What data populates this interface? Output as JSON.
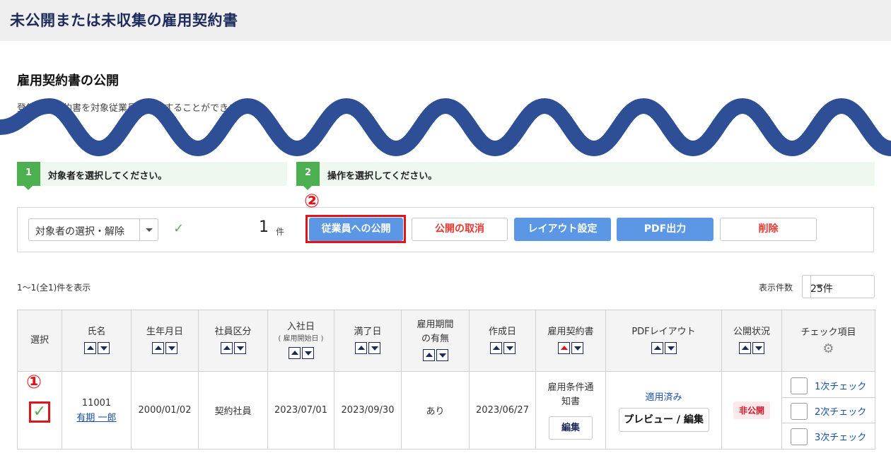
{
  "page": {
    "title": "未公開または未収集の雇用契約書"
  },
  "section": {
    "title": "雇用契約書の公開",
    "description": "登録した契約書を対象従業員へ公開することができます。"
  },
  "steps": [
    {
      "num": "1",
      "label": "対象者を選択してください。"
    },
    {
      "num": "2",
      "label": "操作を選択してください。"
    }
  ],
  "toolbar": {
    "select_label": "対象者の選択・解除",
    "selected_count": "1",
    "count_unit": "件",
    "publish": "従業員への公開",
    "cancel_publish": "公開の取消",
    "layout": "レイアウト設定",
    "pdf": "PDF出力",
    "delete": "削除"
  },
  "markers": {
    "m1": "①",
    "m2": "②"
  },
  "list": {
    "showing": "1〜1(全1)件を表示",
    "per_page_label": "表示件数",
    "per_page_value": "25件"
  },
  "table": {
    "headers": {
      "select": "選択",
      "name": "氏名",
      "birth": "生年月日",
      "type": "社員区分",
      "hire": "入社日",
      "hire_sub": "( 雇用開始日 )",
      "end": "満了日",
      "period_1": "雇用期間",
      "period_2": "の有無",
      "created": "作成日",
      "contract": "雇用契約書",
      "pdf_layout": "PDFレイアウト",
      "status": "公開状況",
      "checks": "チェック項目"
    },
    "rows": [
      {
        "id": "11001",
        "name": "有期 一郎",
        "birth": "2000/01/02",
        "type": "契約社員",
        "hire": "2023/07/01",
        "end": "2023/09/30",
        "period": "あり",
        "created": "2023/06/27",
        "contract_1": "雇用条件通",
        "contract_2": "知書",
        "edit": "編集",
        "applied": "適用済み",
        "preview": "プレビュー / 編集",
        "status": "非公開",
        "check1": "1次チェック",
        "check2": "2次チェック",
        "check3": "3次チェック"
      }
    ]
  },
  "colors": {
    "accent": "#5b97e5",
    "highlight": "#e0141b",
    "step": "#4caf50",
    "wave": "#2e4f96"
  }
}
